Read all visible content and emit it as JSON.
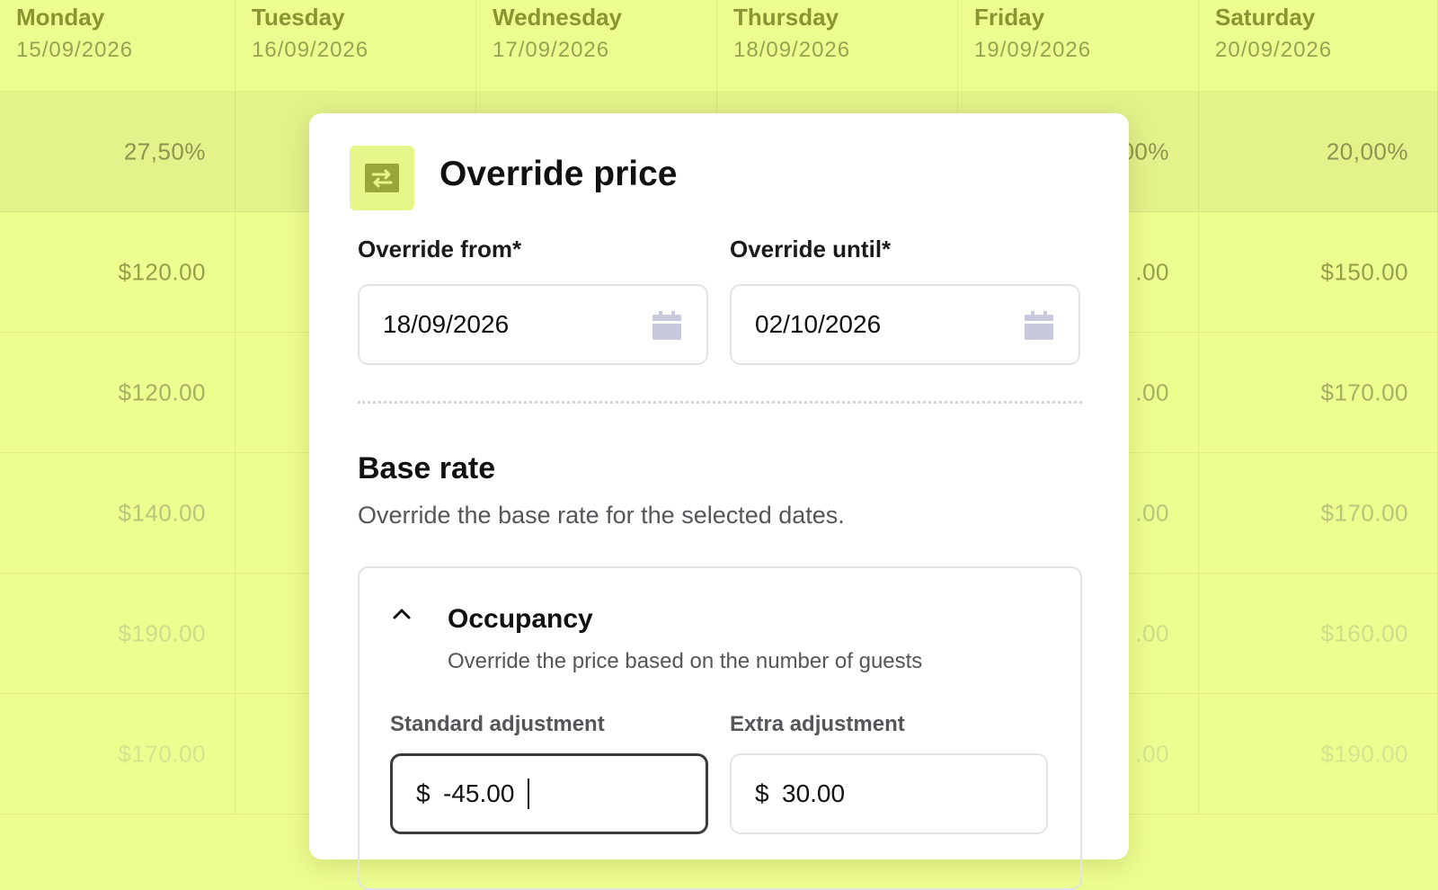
{
  "calendar": {
    "days": [
      {
        "name": "Monday",
        "date": "15/09/2026"
      },
      {
        "name": "Tuesday",
        "date": "16/09/2026"
      },
      {
        "name": "Wednesday",
        "date": "17/09/2026"
      },
      {
        "name": "Thursday",
        "date": "18/09/2026"
      },
      {
        "name": "Friday",
        "date": "19/09/2026"
      },
      {
        "name": "Saturday",
        "date": "20/09/2026"
      }
    ],
    "rows": [
      [
        "27,50%",
        "",
        "",
        "",
        "00%",
        "20,00%"
      ],
      [
        "$120.00",
        "",
        "",
        "",
        ".00",
        "$150.00"
      ],
      [
        "$120.00",
        "",
        "",
        "",
        ".00",
        "$170.00"
      ],
      [
        "$140.00",
        "",
        "",
        "",
        ".00",
        "$170.00"
      ],
      [
        "$190.00",
        "",
        "",
        "",
        ".00",
        "$160.00"
      ],
      [
        "$170.00",
        "",
        "",
        "",
        ".00",
        "$190.00"
      ]
    ]
  },
  "modal": {
    "title": "Override price",
    "icon": "swap-arrows-icon",
    "override_from": {
      "label": "Override from*",
      "value": "18/09/2026",
      "icon": "calendar-icon"
    },
    "override_until": {
      "label": "Override until*",
      "value": "02/10/2026",
      "icon": "calendar-icon"
    },
    "base_rate": {
      "title": "Base rate",
      "description": "Override the base rate for the selected dates."
    },
    "occupancy": {
      "title": "Occupancy",
      "description": "Override the price based on the number of guests",
      "standard": {
        "label": "Standard adjustment",
        "currency": "$",
        "value": "-45.00"
      },
      "extra": {
        "label": "Extra adjustment",
        "currency": "$",
        "value": "30.00"
      }
    }
  },
  "colors": {
    "background": "#eefd90",
    "accent": "#e6f68a",
    "modal": "#ffffff"
  }
}
